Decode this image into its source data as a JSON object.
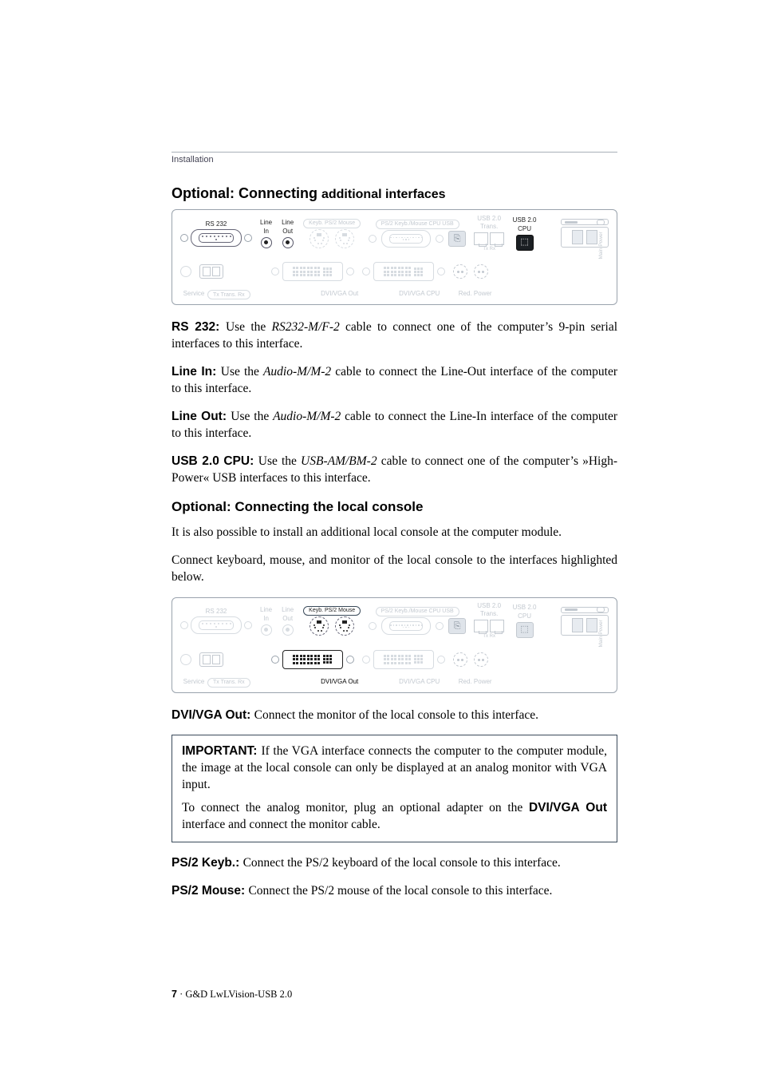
{
  "header": {
    "section": "Installation"
  },
  "h1": {
    "main": "Optional: Connecting ",
    "sub": "additional interfaces"
  },
  "panel1": {
    "top": {
      "rs232": "RS 232",
      "linein": "Line In",
      "lineout": "Line Out",
      "keybps2": "Keyb. PS/2 Mouse",
      "ps2cpu": "PS/2  Keyb./Mouse CPU  USB",
      "usb20trans": "USB 2.0 Trans.",
      "txrx": "Tx   Rx",
      "usb20cpu": "USB 2.0 CPU"
    },
    "bot": {
      "service": "Service",
      "transpill": "Tx  Trans.  Rx",
      "dviout": "DVI/VGA Out",
      "dvicpu": "DVI/VGA CPU",
      "redpower": "Red. Power",
      "mainpower": "Main Power"
    }
  },
  "p_rs232": {
    "lead": "RS 232: ",
    "body1": "Use the ",
    "ital": "RS232-M/F-2",
    "body2": " cable to connect one of the computer’s 9-pin serial interfaces to this interface."
  },
  "p_linein": {
    "lead": "Line In: ",
    "body1": "Use the ",
    "ital": "Audio-M/M-2",
    "body2": " cable to connect the Line-Out interface of the compu­ter to this interface."
  },
  "p_lineout": {
    "lead": "Line Out: ",
    "body1": "Use the ",
    "ital": "Audio-M/M-2",
    "body2": " cable to connect the Line-In interface of the computer to this interface."
  },
  "p_usb20": {
    "lead": "USB 2.0 CPU: ",
    "body1": "Use the ",
    "ital": "USB-AM/BM-2",
    "body2": " cable to connect one of the computer’s »High-Power« USB interfaces to this interface."
  },
  "h2": "Optional: Connecting the local console",
  "p_intro1": "It is also possible to install an additional local console at the computer module.",
  "p_intro2": "Connect keyboard, mouse, and monitor of the local console to the interfaces high­lighted below.",
  "p_dviout": {
    "lead": "DVI/VGA Out: ",
    "body": "Connect the monitor of the local console to this interface."
  },
  "notice": {
    "lead": "IMPORTANT: ",
    "p1": "If the VGA interface connects the computer to the computer mod­ule, the image at the local console can only be displayed at an analog monitor with VGA input.",
    "p2a": "To connect the analog monitor, plug an optional adapter on the ",
    "p2b": "DVI/VGA Out",
    "p2c": " interface and connect the monitor cable."
  },
  "p_ps2k": {
    "lead": "PS/2 Keyb.: ",
    "body": "Connect the PS/2 keyboard of the local console to this interface."
  },
  "p_ps2m": {
    "lead": "PS/2 Mouse: ",
    "body": "Connect the PS/2 mouse of the local console to this interface."
  },
  "footer": {
    "page": "7",
    "sep": " · ",
    "doc": "G&D LwLVision-USB 2.0"
  }
}
